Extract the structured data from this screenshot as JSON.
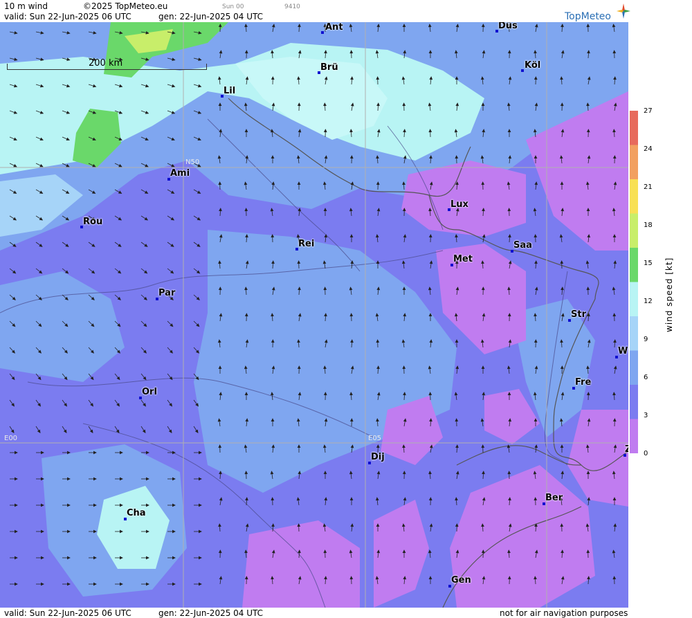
{
  "header": {
    "product": "10 m wind",
    "copyright": "©2025 TopMeteo.eu",
    "run_small": "Sun 00",
    "code_small": "9410",
    "valid": "valid:  Sun  22-Jun-2025  06 UTC",
    "gen": "gen: 22-Jun-2025 04 UTC",
    "logo": "TopMeteo"
  },
  "scale_bar": {
    "label": "200 km"
  },
  "grid_labels": {
    "lat": "N50",
    "lon_e00": "E00",
    "lon_e05": "E05"
  },
  "cities": [
    {
      "name": "Ant"
    },
    {
      "name": "Düs"
    },
    {
      "name": "Brü"
    },
    {
      "name": "Köl"
    },
    {
      "name": "Lil"
    },
    {
      "name": "Ami"
    },
    {
      "name": "Lux"
    },
    {
      "name": "Rou"
    },
    {
      "name": "Rei"
    },
    {
      "name": "Saa"
    },
    {
      "name": "Met"
    },
    {
      "name": "Par"
    },
    {
      "name": "Str"
    },
    {
      "name": "W"
    },
    {
      "name": "Fre"
    },
    {
      "name": "Orl"
    },
    {
      "name": "Dij"
    },
    {
      "name": "Z"
    },
    {
      "name": "Ber"
    },
    {
      "name": "Cha"
    },
    {
      "name": "Gen"
    }
  ],
  "legend": {
    "title": "wind speed [kt]",
    "ticks": [
      "27",
      "24",
      "21",
      "18",
      "15",
      "12",
      "9",
      "6",
      "3",
      "0"
    ],
    "colors": [
      "#e76a5c",
      "#f2a060",
      "#f8e055",
      "#c8ee6a",
      "#6ad86a",
      "#b8f4f4",
      "#a6d4f8",
      "#7fa6f0",
      "#7b7cf0",
      "#c07cf0"
    ]
  },
  "footer": {
    "valid": "valid:  Sun  22-Jun-2025  06 UTC",
    "gen": "gen: 22-Jun-2025 04 UTC",
    "note": "not for air navigation purposes"
  }
}
